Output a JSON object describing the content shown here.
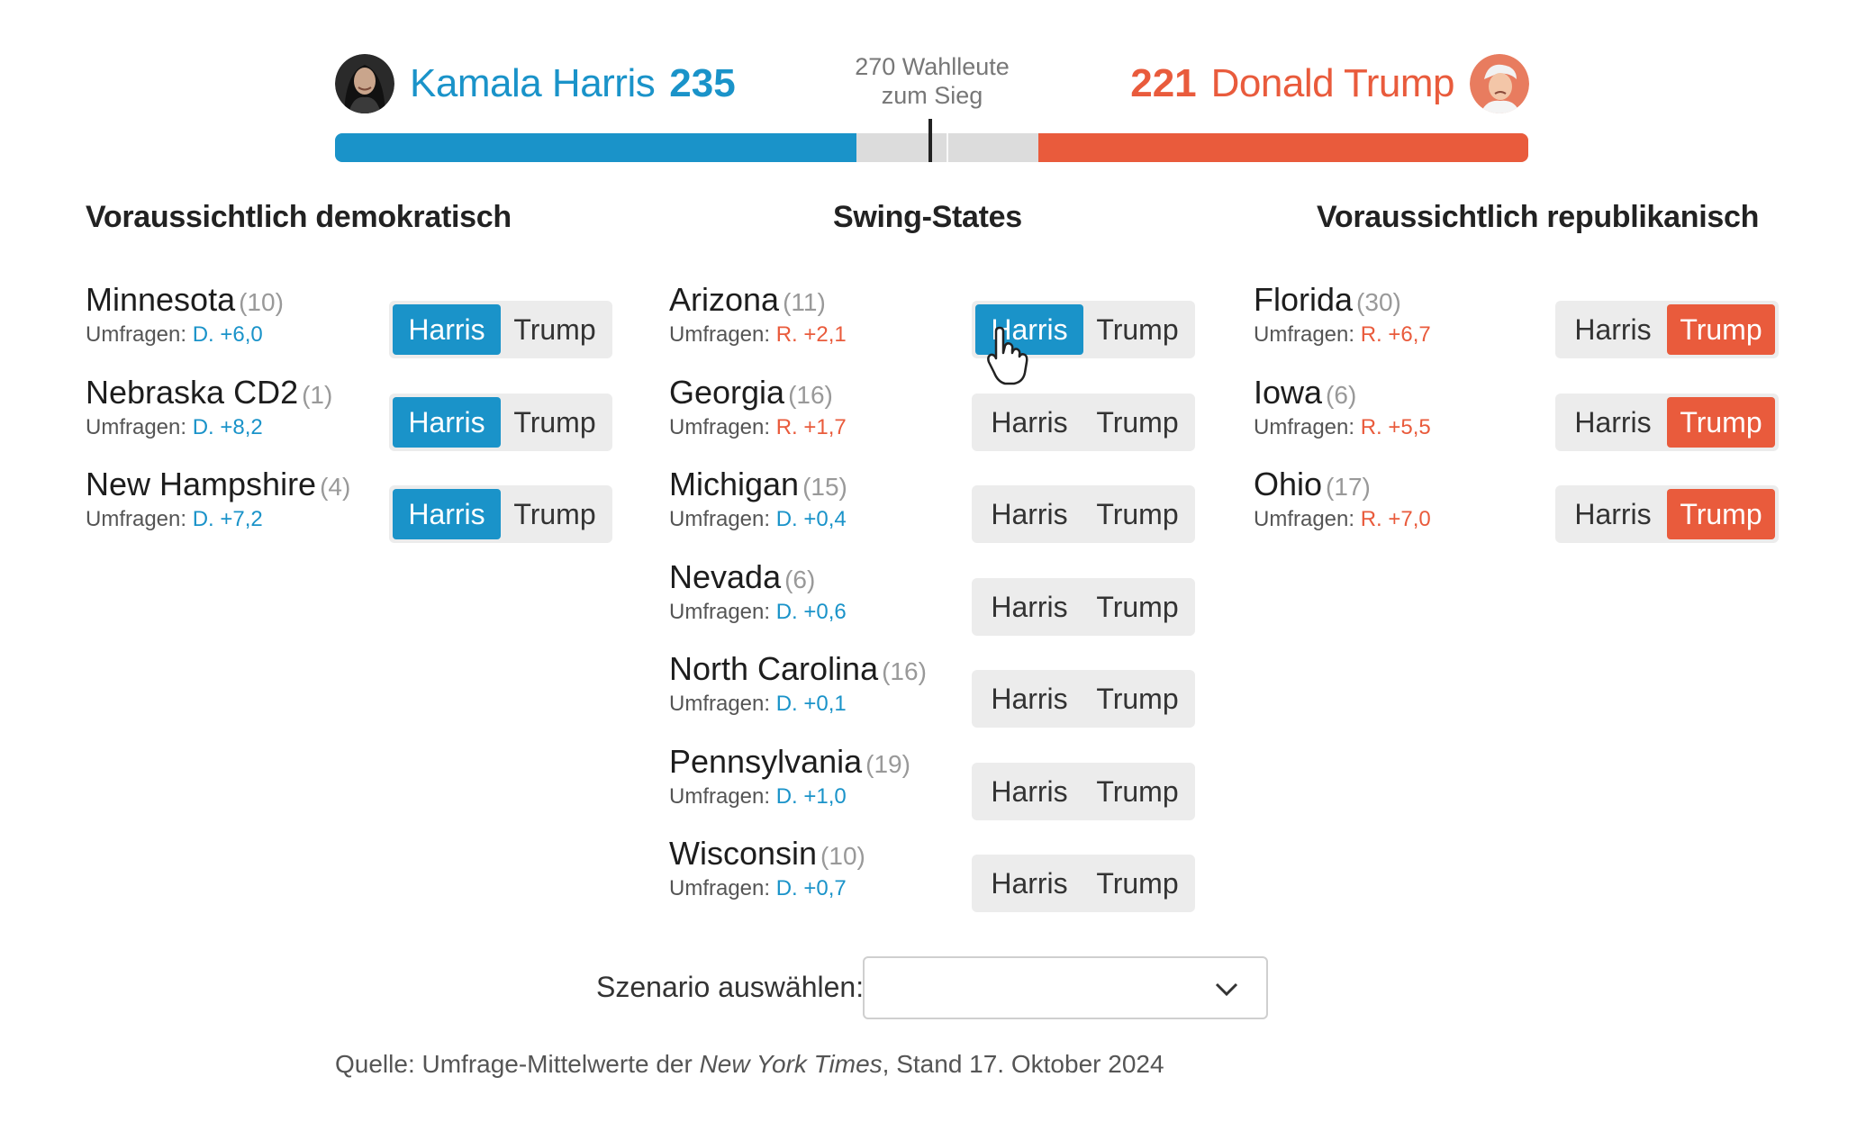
{
  "header": {
    "harris": {
      "name": "Kamala Harris",
      "count": "235",
      "color": "#1a93c9",
      "avatar_icon": "harris-portrait"
    },
    "trump": {
      "name": "Donald Trump",
      "count": "221",
      "color": "#e95b3c",
      "avatar_icon": "trump-portrait"
    },
    "threshold": {
      "line1": "270 Wahlleute",
      "line2": "zum Sieg"
    },
    "progress": {
      "harris_electors": 235,
      "trump_electors": 221,
      "total_electors": 538,
      "to_win": 270
    }
  },
  "columns": {
    "democratic": {
      "title": "Voraussichtlich demokratisch"
    },
    "swing": {
      "title": "Swing-States"
    },
    "republican": {
      "title": "Voraussichtlich republikanisch"
    }
  },
  "poll_prefix": "Umfragen:",
  "toggle_labels": {
    "harris": "Harris",
    "trump": "Trump"
  },
  "democratic_states": [
    {
      "name": "Minnesota",
      "ev": "(10)",
      "poll": "D. +6,0",
      "party": "D",
      "selected": "harris"
    },
    {
      "name": "Nebraska CD2",
      "ev": "(1)",
      "poll": "D. +8,2",
      "party": "D",
      "selected": "harris"
    },
    {
      "name": "New Hampshire",
      "ev": "(4)",
      "poll": "D. +7,2",
      "party": "D",
      "selected": "harris"
    }
  ],
  "swing_states": [
    {
      "name": "Arizona",
      "ev": "(11)",
      "poll": "R. +2,1",
      "party": "R",
      "selected": "harris"
    },
    {
      "name": "Georgia",
      "ev": "(16)",
      "poll": "R. +1,7",
      "party": "R",
      "selected": ""
    },
    {
      "name": "Michigan",
      "ev": "(15)",
      "poll": "D. +0,4",
      "party": "D",
      "selected": ""
    },
    {
      "name": "Nevada",
      "ev": "(6)",
      "poll": "D. +0,6",
      "party": "D",
      "selected": ""
    },
    {
      "name": "North Carolina",
      "ev": "(16)",
      "poll": "D. +0,1",
      "party": "D",
      "selected": ""
    },
    {
      "name": "Pennsylvania",
      "ev": "(19)",
      "poll": "D. +1,0",
      "party": "D",
      "selected": ""
    },
    {
      "name": "Wisconsin",
      "ev": "(10)",
      "poll": "D. +0,7",
      "party": "D",
      "selected": ""
    }
  ],
  "republican_states": [
    {
      "name": "Florida",
      "ev": "(30)",
      "poll": "R. +6,7",
      "party": "R",
      "selected": "trump"
    },
    {
      "name": "Iowa",
      "ev": "(6)",
      "poll": "R. +5,5",
      "party": "R",
      "selected": "trump"
    },
    {
      "name": "Ohio",
      "ev": "(17)",
      "poll": "R. +7,0",
      "party": "R",
      "selected": "trump"
    }
  ],
  "scenario": {
    "label": "Szenario auswählen:",
    "value": "",
    "icon": "chevron-down-icon"
  },
  "source": {
    "prefix": "Quelle: Umfrage-Mittelwerte der ",
    "publication": "New York Times",
    "suffix": ", Stand 17. Oktober 2024"
  },
  "cursor_icon": "hand-pointer-icon"
}
